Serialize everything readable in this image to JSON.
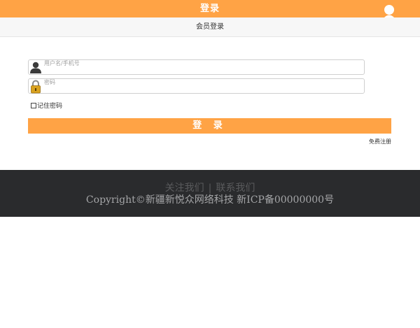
{
  "header": {
    "title": "登录",
    "avatar_icon": "user-icon"
  },
  "subheader": {
    "title": "会员登录"
  },
  "login_form": {
    "username": {
      "value": "",
      "placeholder": "用户名/手机号",
      "icon": "user-avatar-icon"
    },
    "password": {
      "value": "",
      "placeholder": "密码",
      "icon": "padlock-icon"
    },
    "remember_label": "记住密码",
    "remember_checked": false,
    "submit_label": "登 录",
    "register_label": "免费注册"
  },
  "footer": {
    "follow_us": "关注我们",
    "separator": "|",
    "contact_us": "联系我们",
    "copyright": "Copyright©新疆新悦众网络科技 新ICP备00000000号"
  },
  "colors": {
    "accent": "#ffa345",
    "footer_bg": "#2a2b2d"
  }
}
